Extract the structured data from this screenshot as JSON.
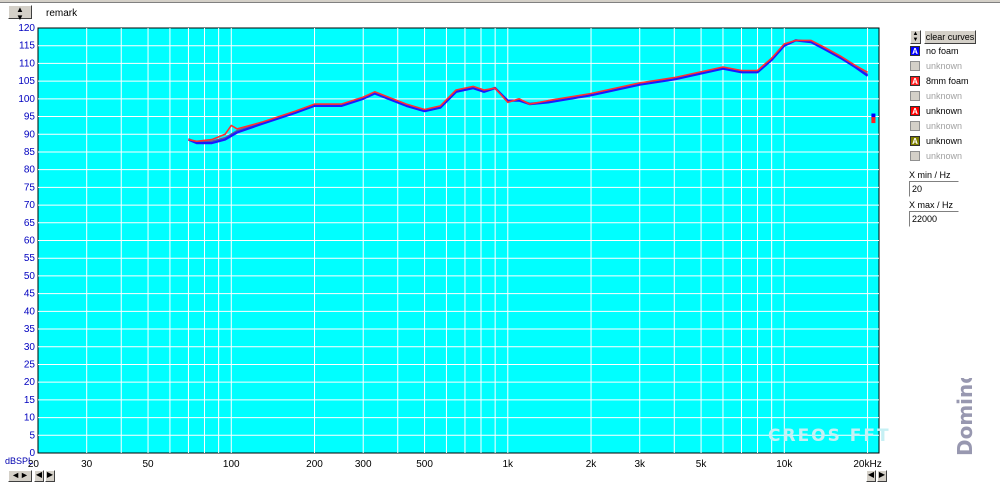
{
  "header": {
    "remark": "remark"
  },
  "controls": {
    "clear_label": "clear curves",
    "xmin_label": "X min / Hz",
    "xmin_value": "20",
    "xmax_label": "X max / Hz",
    "xmax_value": "22000"
  },
  "legend": [
    {
      "letter": "A",
      "label": "no foam",
      "color": "#0000ff",
      "active": true
    },
    {
      "letter": "",
      "label": "unknown",
      "color": "#a0a0a0",
      "active": false
    },
    {
      "letter": "A",
      "label": "8mm foam",
      "color": "#ff2020",
      "active": true
    },
    {
      "letter": "",
      "label": "unknown",
      "color": "#a0a0a0",
      "active": false
    },
    {
      "letter": "A",
      "label": "unknown",
      "color": "#ff0000",
      "active": true
    },
    {
      "letter": "",
      "label": "unknown",
      "color": "#a0a0a0",
      "active": false
    },
    {
      "letter": "A",
      "label": "unknown",
      "color": "#808000",
      "active": true
    },
    {
      "letter": "",
      "label": "unknown",
      "color": "#a0a0a0",
      "active": false
    }
  ],
  "branding": {
    "watermark": "CREOS FFT",
    "logo": "Domino"
  },
  "chart_data": {
    "type": "line",
    "xscale": "log",
    "xlim": [
      20,
      22000
    ],
    "ylim": [
      0,
      120
    ],
    "grid": true,
    "ylabel": "dBSPL",
    "xlabel": "",
    "x_ticks": [
      20,
      30,
      50,
      100,
      200,
      300,
      500,
      1000,
      2000,
      3000,
      5000,
      10000,
      20000
    ],
    "x_tick_labels": [
      "20",
      "30",
      "50",
      "100",
      "200",
      "300",
      "500",
      "1k",
      "2k",
      "3k",
      "5k",
      "10k",
      "20kHz"
    ],
    "y_ticks": [
      0,
      5,
      10,
      15,
      20,
      25,
      30,
      35,
      40,
      45,
      50,
      55,
      60,
      65,
      70,
      75,
      80,
      85,
      90,
      95,
      100,
      105,
      110,
      115,
      120
    ],
    "series": [
      {
        "name": "no foam",
        "color": "#1a1aff",
        "x": [
          70,
          75,
          85,
          95,
          105,
          130,
          170,
          200,
          250,
          300,
          330,
          370,
          430,
          500,
          570,
          650,
          750,
          820,
          900,
          1000,
          1100,
          1200,
          1400,
          2000,
          3000,
          4000,
          6000,
          7000,
          8000,
          9000,
          10000,
          11000,
          12500,
          14000,
          16000,
          18000,
          20000
        ],
        "y": [
          88.5,
          87.5,
          87.5,
          88.5,
          90.5,
          93,
          96,
          98,
          98,
          100,
          101.5,
          100,
          98,
          96.5,
          97.5,
          102,
          103,
          102,
          103,
          99.5,
          99.5,
          98.5,
          99,
          101,
          104,
          105.5,
          108.5,
          107.5,
          107.5,
          111,
          115,
          116.5,
          116,
          114,
          111.5,
          109,
          106.5
        ]
      },
      {
        "name": "8mm foam",
        "color": "#ff3030",
        "x": [
          70,
          75,
          85,
          95,
          100,
          105,
          130,
          170,
          200,
          250,
          300,
          330,
          370,
          430,
          500,
          570,
          650,
          750,
          820,
          900,
          1000,
          1100,
          1200,
          1400,
          2000,
          3000,
          4000,
          6000,
          7000,
          8000,
          9000,
          10000,
          11000,
          12500,
          14000,
          16000,
          18000,
          20000
        ],
        "y": [
          88.5,
          88,
          88.5,
          90,
          92.5,
          91.5,
          93.5,
          96.5,
          98.5,
          98.5,
          100.5,
          102,
          100.5,
          98.5,
          97,
          98,
          102.5,
          103.5,
          102.5,
          103,
          99,
          100,
          98.5,
          99.5,
          101.5,
          104.5,
          106,
          109,
          108,
          108,
          111.5,
          115.5,
          116.5,
          116.5,
          114.5,
          112,
          109.5,
          107.5
        ]
      },
      {
        "name": "unknown",
        "color": "#5a5aa0",
        "x": [
          70,
          75,
          85,
          95,
          105,
          130,
          170,
          200,
          250,
          300,
          330,
          370,
          430,
          500,
          570,
          650,
          750,
          820,
          900,
          1000,
          1100,
          1200,
          1400,
          2000,
          3000,
          4000,
          6000,
          7000,
          8000,
          9000,
          10000,
          11000,
          12500,
          14000,
          16000,
          18000,
          20000
        ],
        "y": [
          88.7,
          87.8,
          88,
          89,
          91,
          93.3,
          96.2,
          98.2,
          98.2,
          100.2,
          101.7,
          100.2,
          98.2,
          96.7,
          97.7,
          102.2,
          103.2,
          102.2,
          103.2,
          99.3,
          99.7,
          98.7,
          99.2,
          101.2,
          104.2,
          105.7,
          108.7,
          107.7,
          107.7,
          111.2,
          115.2,
          116.6,
          116.2,
          114.2,
          111.7,
          109.2,
          106.9
        ]
      }
    ],
    "markers": [
      {
        "x": 21000,
        "y": 95,
        "color": "#0000ff"
      },
      {
        "x": 21000,
        "y": 94,
        "color": "#ff2020"
      }
    ]
  }
}
